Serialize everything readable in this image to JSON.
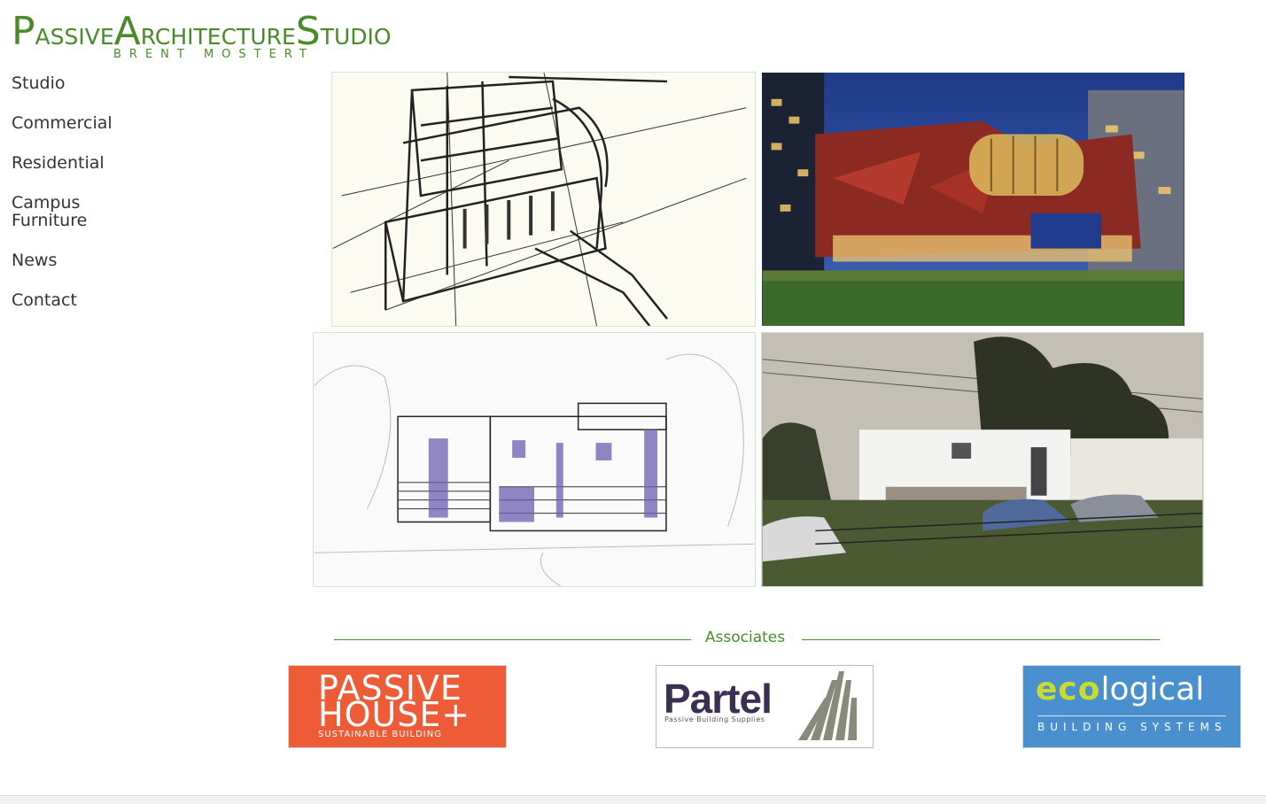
{
  "logo": {
    "p": "P",
    "assive": "ASSIVE",
    "a": "A",
    "rchitecture": "RCHITECTURE",
    "s": "S",
    "tudio": "TUDIO",
    "subtitle": "BRENT MOSTERT"
  },
  "nav": [
    {
      "label": "Studio"
    },
    {
      "label": "Commercial"
    },
    {
      "label": "Residential"
    },
    {
      "label": "Campus"
    },
    {
      "label": "Furniture"
    },
    {
      "label": "News"
    },
    {
      "label": "Contact"
    }
  ],
  "associates": {
    "title": "Associates",
    "passive_house": {
      "line1": "PASSIVE",
      "line2": "HOUSE+",
      "sub": "SUSTAINABLE BUILDING"
    },
    "partel": {
      "name": "Partel",
      "sub": "Passive Building Supplies"
    },
    "ecological": {
      "eco": "eco",
      "logical": "logical",
      "sub": "BUILDING SYSTEMS"
    }
  },
  "colors": {
    "brand_green": "#4a8a2a",
    "passive_orange": "#ed5b37",
    "eco_blue": "#4a90cf"
  }
}
